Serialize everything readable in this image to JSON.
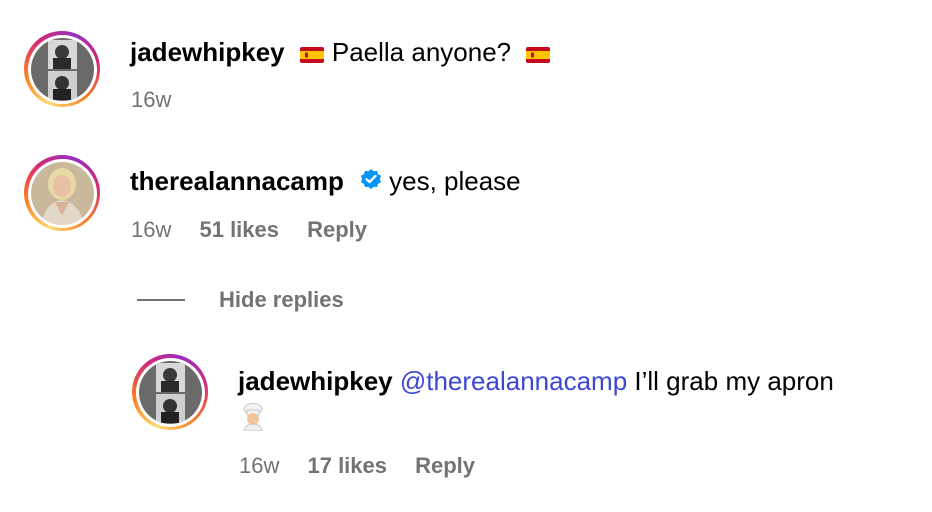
{
  "comments": [
    {
      "username": "jadewhipkey",
      "flag_before": "spain-flag-icon",
      "text": "Paella anyone?",
      "flag_after": "spain-flag-icon",
      "time": "16w"
    },
    {
      "username": "therealannacamp",
      "verified": "verified-badge-icon",
      "text": "yes, please",
      "time": "16w",
      "likes": "51 likes",
      "reply_label": "Reply"
    }
  ],
  "replies_toggle": {
    "label": "Hide replies"
  },
  "reply": {
    "username": "jadewhipkey",
    "mention": "@therealannacamp",
    "text": "I’ll grab my apron",
    "emoji": "chef-emoji-icon",
    "time": "16w",
    "likes": "17 likes",
    "reply_label": "Reply"
  },
  "colors": {
    "mention": "#3d47d6",
    "meta": "#737373",
    "verified": "#0095f6"
  }
}
